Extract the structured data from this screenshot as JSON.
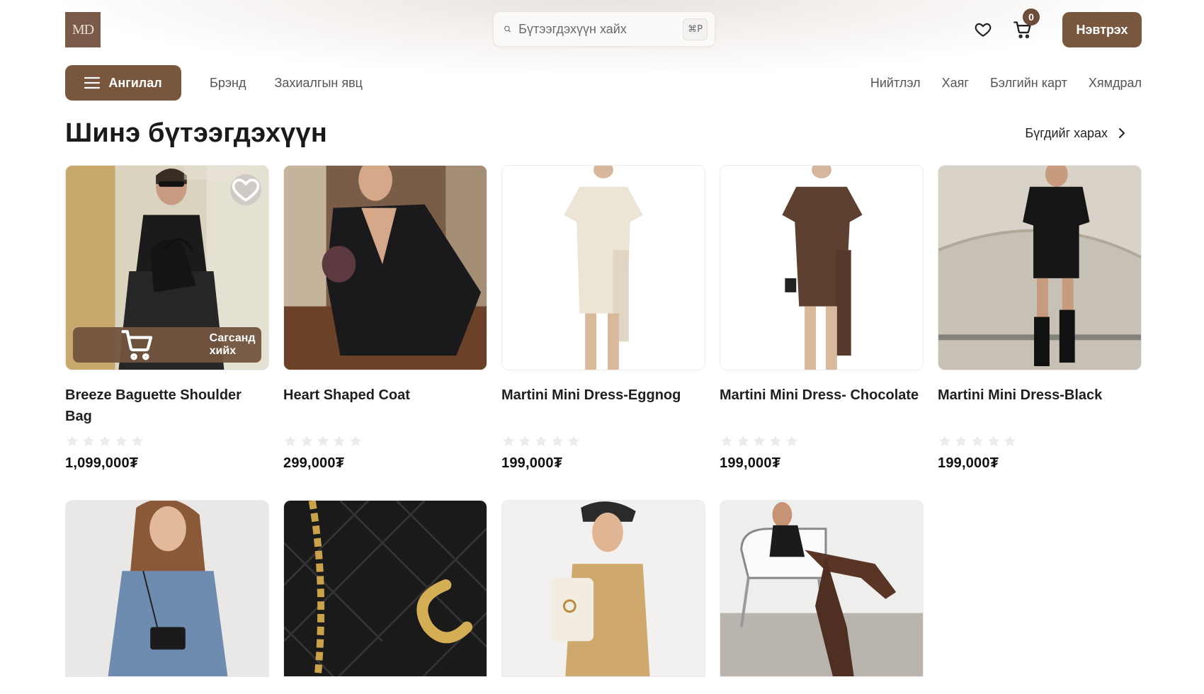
{
  "header": {
    "logo_text": "MD",
    "search_placeholder": "Бүтээгдэхүүн хайх",
    "search_shortcut": "⌘P",
    "cart_count": "0",
    "login_label": "Нэвтрэх"
  },
  "nav": {
    "category_label": "Ангилал",
    "left_links": [
      "Брэнд",
      "Захиалгын явц"
    ],
    "right_links": [
      "Нийтлэл",
      "Хаяг",
      "Бэлгийн карт",
      "Хямдрал"
    ]
  },
  "section": {
    "title": "Шинэ бүтээгдэхүүн",
    "view_all": "Бүгдийг харах"
  },
  "card_actions": {
    "add_to_cart": "Сагсанд хийх"
  },
  "products": [
    {
      "name": "Breeze Baguette Shoulder Bag",
      "price": "1,099,000₮",
      "rating": 0,
      "image": "woman-with-black-bag"
    },
    {
      "name": "Heart Shaped Coat",
      "price": "299,000₮",
      "rating": 0,
      "image": "woman-in-black-coat"
    },
    {
      "name": "Martini Mini Dress-Eggnog",
      "price": "199,000₮",
      "rating": 0,
      "image": "cream-mini-dress"
    },
    {
      "name": "Martini Mini Dress- Chocolate",
      "price": "199,000₮",
      "rating": 0,
      "image": "brown-mini-dress"
    },
    {
      "name": "Martini Mini Dress-Black",
      "price": "199,000₮",
      "rating": 0,
      "image": "black-mini-dress"
    }
  ],
  "products_row2": [
    {
      "image": "woman-in-denim-with-crossbody"
    },
    {
      "image": "black-quilted-bag"
    },
    {
      "image": "woman-with-cream-backpack"
    },
    {
      "image": "woman-in-brown-boots"
    }
  ],
  "colors": {
    "accent": "#79573f",
    "badge": "#6d4c3a"
  }
}
